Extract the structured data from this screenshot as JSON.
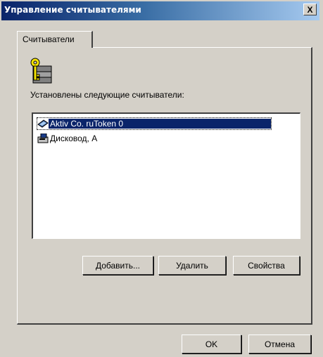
{
  "window": {
    "title": "Управление считывателями",
    "close_label": "X"
  },
  "tabs": [
    {
      "label": "Считыватели"
    }
  ],
  "panel": {
    "installed_label": "Установлены следующие считыватели:"
  },
  "readers": [
    {
      "label": "Aktiv Co. ruToken 0",
      "icon": "token-reader-icon",
      "selected": true
    },
    {
      "label": "Дисковод, A",
      "icon": "floppy-drive-icon",
      "selected": false
    }
  ],
  "buttons": {
    "add": "Добавить...",
    "remove": "Удалить",
    "properties": "Свойства",
    "ok": "OK",
    "cancel": "Отмена"
  },
  "colors": {
    "title_start": "#0a246a",
    "title_end": "#a6caf0",
    "face": "#d4d0c8",
    "selection": "#0a246a"
  }
}
